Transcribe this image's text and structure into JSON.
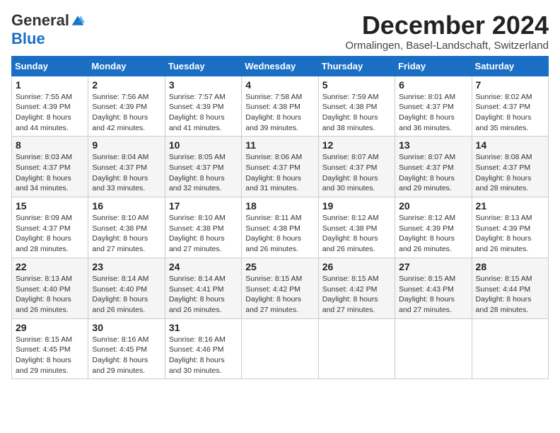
{
  "logo": {
    "general": "General",
    "blue": "Blue"
  },
  "title": "December 2024",
  "subtitle": "Ormalingen, Basel-Landschaft, Switzerland",
  "weekdays": [
    "Sunday",
    "Monday",
    "Tuesday",
    "Wednesday",
    "Thursday",
    "Friday",
    "Saturday"
  ],
  "weeks": [
    [
      {
        "day": "1",
        "sunrise": "7:55 AM",
        "sunset": "4:39 PM",
        "daylight": "8 hours and 44 minutes."
      },
      {
        "day": "2",
        "sunrise": "7:56 AM",
        "sunset": "4:39 PM",
        "daylight": "8 hours and 42 minutes."
      },
      {
        "day": "3",
        "sunrise": "7:57 AM",
        "sunset": "4:39 PM",
        "daylight": "8 hours and 41 minutes."
      },
      {
        "day": "4",
        "sunrise": "7:58 AM",
        "sunset": "4:38 PM",
        "daylight": "8 hours and 39 minutes."
      },
      {
        "day": "5",
        "sunrise": "7:59 AM",
        "sunset": "4:38 PM",
        "daylight": "8 hours and 38 minutes."
      },
      {
        "day": "6",
        "sunrise": "8:01 AM",
        "sunset": "4:37 PM",
        "daylight": "8 hours and 36 minutes."
      },
      {
        "day": "7",
        "sunrise": "8:02 AM",
        "sunset": "4:37 PM",
        "daylight": "8 hours and 35 minutes."
      }
    ],
    [
      {
        "day": "8",
        "sunrise": "8:03 AM",
        "sunset": "4:37 PM",
        "daylight": "8 hours and 34 minutes."
      },
      {
        "day": "9",
        "sunrise": "8:04 AM",
        "sunset": "4:37 PM",
        "daylight": "8 hours and 33 minutes."
      },
      {
        "day": "10",
        "sunrise": "8:05 AM",
        "sunset": "4:37 PM",
        "daylight": "8 hours and 32 minutes."
      },
      {
        "day": "11",
        "sunrise": "8:06 AM",
        "sunset": "4:37 PM",
        "daylight": "8 hours and 31 minutes."
      },
      {
        "day": "12",
        "sunrise": "8:07 AM",
        "sunset": "4:37 PM",
        "daylight": "8 hours and 30 minutes."
      },
      {
        "day": "13",
        "sunrise": "8:07 AM",
        "sunset": "4:37 PM",
        "daylight": "8 hours and 29 minutes."
      },
      {
        "day": "14",
        "sunrise": "8:08 AM",
        "sunset": "4:37 PM",
        "daylight": "8 hours and 28 minutes."
      }
    ],
    [
      {
        "day": "15",
        "sunrise": "8:09 AM",
        "sunset": "4:37 PM",
        "daylight": "8 hours and 28 minutes."
      },
      {
        "day": "16",
        "sunrise": "8:10 AM",
        "sunset": "4:38 PM",
        "daylight": "8 hours and 27 minutes."
      },
      {
        "day": "17",
        "sunrise": "8:10 AM",
        "sunset": "4:38 PM",
        "daylight": "8 hours and 27 minutes."
      },
      {
        "day": "18",
        "sunrise": "8:11 AM",
        "sunset": "4:38 PM",
        "daylight": "8 hours and 26 minutes."
      },
      {
        "day": "19",
        "sunrise": "8:12 AM",
        "sunset": "4:38 PM",
        "daylight": "8 hours and 26 minutes."
      },
      {
        "day": "20",
        "sunrise": "8:12 AM",
        "sunset": "4:39 PM",
        "daylight": "8 hours and 26 minutes."
      },
      {
        "day": "21",
        "sunrise": "8:13 AM",
        "sunset": "4:39 PM",
        "daylight": "8 hours and 26 minutes."
      }
    ],
    [
      {
        "day": "22",
        "sunrise": "8:13 AM",
        "sunset": "4:40 PM",
        "daylight": "8 hours and 26 minutes."
      },
      {
        "day": "23",
        "sunrise": "8:14 AM",
        "sunset": "4:40 PM",
        "daylight": "8 hours and 26 minutes."
      },
      {
        "day": "24",
        "sunrise": "8:14 AM",
        "sunset": "4:41 PM",
        "daylight": "8 hours and 26 minutes."
      },
      {
        "day": "25",
        "sunrise": "8:15 AM",
        "sunset": "4:42 PM",
        "daylight": "8 hours and 27 minutes."
      },
      {
        "day": "26",
        "sunrise": "8:15 AM",
        "sunset": "4:42 PM",
        "daylight": "8 hours and 27 minutes."
      },
      {
        "day": "27",
        "sunrise": "8:15 AM",
        "sunset": "4:43 PM",
        "daylight": "8 hours and 27 minutes."
      },
      {
        "day": "28",
        "sunrise": "8:15 AM",
        "sunset": "4:44 PM",
        "daylight": "8 hours and 28 minutes."
      }
    ],
    [
      {
        "day": "29",
        "sunrise": "8:15 AM",
        "sunset": "4:45 PM",
        "daylight": "8 hours and 29 minutes."
      },
      {
        "day": "30",
        "sunrise": "8:16 AM",
        "sunset": "4:45 PM",
        "daylight": "8 hours and 29 minutes."
      },
      {
        "day": "31",
        "sunrise": "8:16 AM",
        "sunset": "4:46 PM",
        "daylight": "8 hours and 30 minutes."
      },
      null,
      null,
      null,
      null
    ]
  ],
  "labels": {
    "sunrise": "Sunrise:",
    "sunset": "Sunset:",
    "daylight": "Daylight:"
  }
}
